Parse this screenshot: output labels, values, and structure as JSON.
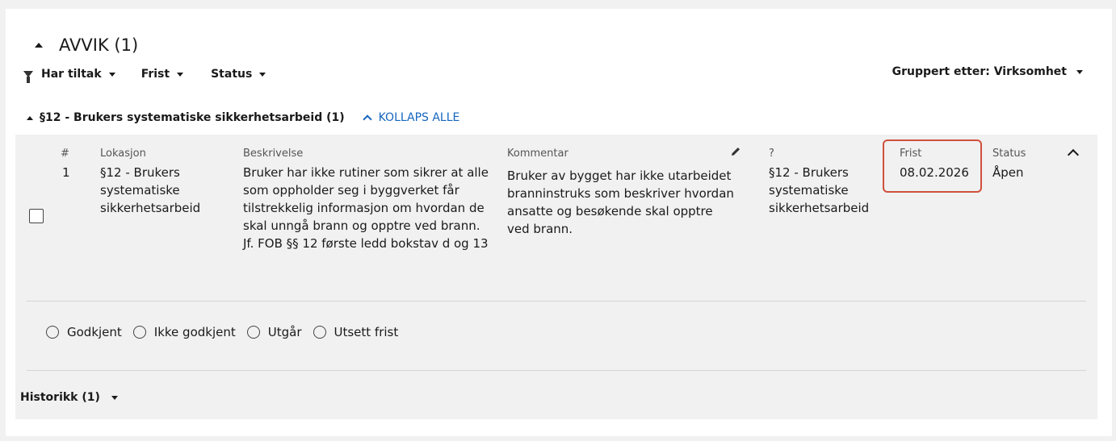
{
  "section": {
    "title": "AVVIK (1)"
  },
  "filters": [
    {
      "label": "Har tiltak"
    },
    {
      "label": "Frist"
    },
    {
      "label": "Status"
    }
  ],
  "group_by": {
    "label": "Gruppert etter: Virksomhet"
  },
  "group": {
    "title": "§12 - Brukers systematiske sikkerhetsarbeid (1)",
    "collapse_all": "KOLLAPS ALLE"
  },
  "columns": {
    "number": "#",
    "location": "Lokasjon",
    "description": "Beskrivelse",
    "comment": "Kommentar",
    "unknown": "?",
    "deadline": "Frist",
    "status": "Status"
  },
  "row": {
    "number": "1",
    "location": "§12 - Brukers systematiske sikkerhetsarbeid",
    "description": "Bruker har ikke rutiner som sikrer at alle som oppholder seg i byggverket får tilstrekkelig informasjon om hvordan de skal unngå brann og opptre ved brann. Jf. FOB §§ 12 første ledd bokstav d og 13",
    "comment": "Bruker av bygget har ikke utarbeidet branninstruks som beskriver hvordan ansatte og besøkende skal opptre ved brann.",
    "unknown": "§12 - Brukers systematiske sikkerhetsarbeid",
    "deadline": "08.02.2026",
    "status": "Åpen"
  },
  "decision_options": [
    {
      "label": "Godkjent"
    },
    {
      "label": "Ikke godkjent"
    },
    {
      "label": "Utgår"
    },
    {
      "label": "Utsett frist"
    }
  ],
  "history": {
    "label": "Historikk (1)"
  },
  "colors": {
    "accent": "#1565c0",
    "highlight": "#d0503c",
    "panel": "#f1f1f1"
  }
}
